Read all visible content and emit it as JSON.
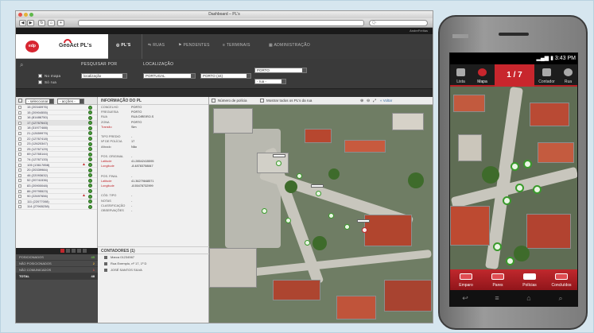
{
  "window": {
    "title": "Dashboard – PL's"
  },
  "app": {
    "logo": "edp",
    "brand": "GeoAct PL's",
    "user": "AndreFreitas"
  },
  "nav": {
    "items": [
      {
        "label": "PL'S",
        "icon": "target-icon",
        "active": true
      },
      {
        "label": "RUAS",
        "icon": "road-icon"
      },
      {
        "label": "PENDENTES",
        "icon": "flag-icon"
      },
      {
        "label": "TERMINAIS",
        "icon": "list-icon"
      },
      {
        "label": "ADMINISTRAÇÃO",
        "icon": "grid-icon"
      }
    ]
  },
  "filters": {
    "search_label": "PESQUISAR POR",
    "location_label": "LOCALIZAÇÃO",
    "search_by_value": "localização",
    "opt_no_map": "No mapa",
    "opt_street": "Só rua",
    "country": "PORTUGAL",
    "district": "PORTO (44)",
    "city": "PORTO",
    "street": "- rua -"
  },
  "list": {
    "select_filter": "- seleccionar -",
    "actions_filter": "- acções -",
    "rows": [
      {
        "id": "15 (20340976)"
      },
      {
        "id": "15 (20904555)"
      },
      {
        "id": "16 (81486750)"
      },
      {
        "id": "17 (12767643)",
        "selected": true
      },
      {
        "id": "18 (31977488)"
      },
      {
        "id": "21 (12659979)"
      },
      {
        "id": "22 (12767418)"
      },
      {
        "id": "23 (12620347)"
      },
      {
        "id": "25 (12767129)"
      },
      {
        "id": "69 (12765144)"
      },
      {
        "id": "74 (12767133)"
      },
      {
        "id": "105 (13617858)",
        "warning": true
      },
      {
        "id": "20 (20339984)"
      },
      {
        "id": "46 (22093632)"
      },
      {
        "id": "52 (20741536)"
      },
      {
        "id": "83 (20900048)"
      },
      {
        "id": "86 (29795523)"
      },
      {
        "id": "90 (22697656)",
        "warning": true
      },
      {
        "id": "111 (22077008)"
      },
      {
        "id": "114 (27965238)"
      }
    ],
    "pages": [
      "1",
      "2",
      "3",
      "4",
      "5"
    ]
  },
  "stats": [
    {
      "label": "POSICIONADOS",
      "value": "45"
    },
    {
      "label": "NÃO POSICIONADOS",
      "value": "2"
    },
    {
      "label": "NÃO COMUNICADOS",
      "value": "1"
    },
    {
      "label": "TOTAL",
      "value": "48"
    }
  ],
  "info": {
    "title": "INFORMAÇÃO DO PL",
    "fields": [
      {
        "key": "CONCELHO",
        "value": "PORTO"
      },
      {
        "key": "FREGUESIA",
        "value": "PORTO"
      },
      {
        "key": "RUA",
        "value": "RUA DIREIRO.S"
      },
      {
        "key": "ZONA",
        "value": "PORTO"
      },
      {
        "key": "Transito",
        "value": "Sim",
        "red": true
      },
      {
        "key": "",
        "value": ""
      },
      {
        "key": "TIPO PREDIO",
        "value": "-"
      },
      {
        "key": "Nº DE POLÍCIA",
        "value": "17"
      },
      {
        "key": "Afixado",
        "value": "Não"
      },
      {
        "key": "",
        "value": ""
      },
      {
        "key": "POS. ORIGINAL",
        "value": "-"
      },
      {
        "key": "Latitude",
        "value": "41.28542415595",
        "red": true
      },
      {
        "key": "Longitude",
        "value": "-8.48783758847",
        "red": true
      },
      {
        "key": "",
        "value": ""
      },
      {
        "key": "POS. FINAL",
        "value": "-"
      },
      {
        "key": "Latitude",
        "value": "41.36279848571",
        "red": true
      },
      {
        "key": "Longitude",
        "value": "-8.55478732999",
        "red": true
      },
      {
        "key": "",
        "value": ""
      },
      {
        "key": "CÓD. TIPO",
        "value": "-"
      },
      {
        "key": "NOTAS",
        "value": "-"
      },
      {
        "key": "CLASSIFICAÇÃO",
        "value": "-"
      },
      {
        "key": "OBSERVAÇÕES",
        "value": "-"
      }
    ],
    "contadores_title": "CONTADORES (1)",
    "contadores": [
      "Marca 01234567",
      "Rua Exemplo, nº 17, 1º D",
      "JOSÉ SANTOS SILVA"
    ]
  },
  "map": {
    "opt_police_number": "Número de polícia",
    "opt_show_all": "Mostrar todos os PL's da rua",
    "back_label": "« Voltar",
    "pin_label": "17"
  },
  "phone": {
    "time": "3:43 PM",
    "tabs": [
      {
        "label": "Lista",
        "icon": "list-icon"
      },
      {
        "label": "Mapa",
        "icon": "map-icon"
      },
      {
        "label": "Contador",
        "icon": "barcode-icon"
      },
      {
        "label": "Rua",
        "icon": "search-icon"
      }
    ],
    "page_counter": "1 / 7",
    "bottom": [
      {
        "label": "Emparo",
        "active": false
      },
      {
        "label": "Pares",
        "active": false
      },
      {
        "label": "Polícias",
        "active": true
      },
      {
        "label": "Concluídos",
        "active": false
      }
    ],
    "nav_icons": [
      "back-icon",
      "menu-icon",
      "home-icon",
      "search-icon"
    ]
  },
  "colors": {
    "accent": "#c8262d",
    "ok": "#3a9a2c",
    "dark": "#3a3a3a"
  }
}
